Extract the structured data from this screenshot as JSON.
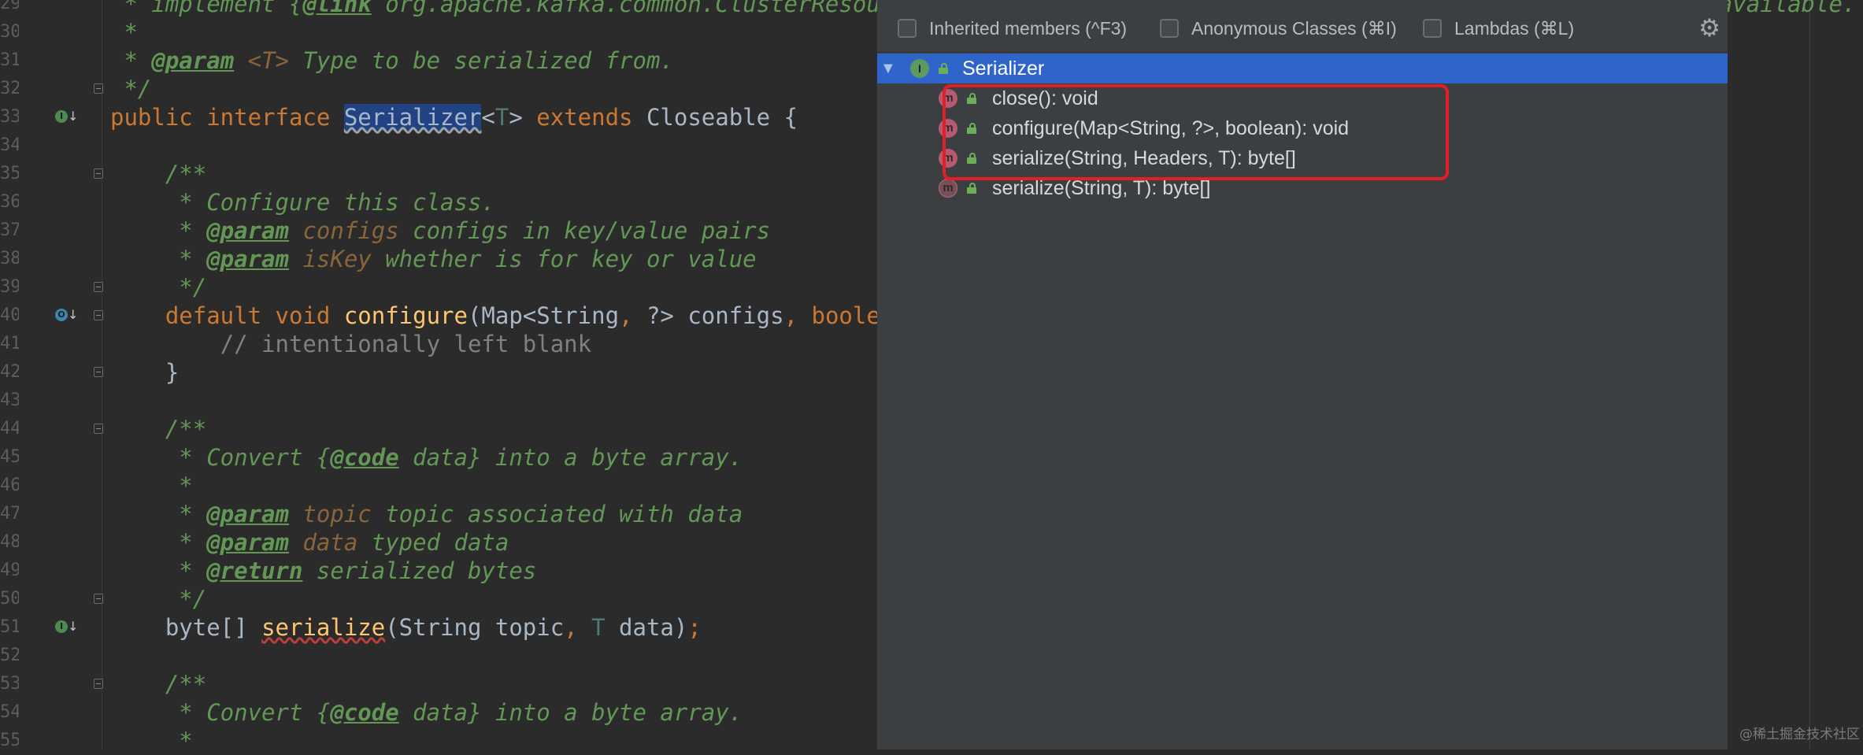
{
  "editor": {
    "lines": [
      {
        "no": "29",
        "parts": [
          {
            "t": " * implement {",
            "s": "c"
          },
          {
            "t": "@link",
            "s": "tag"
          },
          {
            "t": " org.apache.kafka.common.ClusterResourceListener} interface to receive cluster metadata once it's available. Please",
            "s": "c"
          }
        ]
      },
      {
        "no": "30",
        "parts": [
          {
            "t": " *",
            "s": "c"
          }
        ]
      },
      {
        "no": "31",
        "parts": [
          {
            "t": " * ",
            "s": "c"
          },
          {
            "t": "@param",
            "s": "tag"
          },
          {
            "t": " ",
            "s": "c"
          },
          {
            "t": "<T>",
            "s": "pn"
          },
          {
            "t": " Type to be serialized from.",
            "s": "c"
          }
        ]
      },
      {
        "no": "32",
        "fold": true,
        "parts": [
          {
            "t": " */",
            "s": "c"
          }
        ]
      },
      {
        "no": "33",
        "gicon": "I",
        "parts": [
          {
            "t": "public interface ",
            "s": "k"
          },
          {
            "t": "Serializer",
            "s": "hl"
          },
          {
            "t": "<",
            "s": ""
          },
          {
            "t": "T",
            "s": "tp"
          },
          {
            "t": "> ",
            "s": ""
          },
          {
            "t": "extends ",
            "s": "k"
          },
          {
            "t": "Closeable {",
            "s": ""
          }
        ]
      },
      {
        "no": "34",
        "parts": []
      },
      {
        "no": "35",
        "fold": true,
        "parts": [
          {
            "t": "    /**",
            "s": "c"
          }
        ]
      },
      {
        "no": "36",
        "parts": [
          {
            "t": "     * Configure this class.",
            "s": "c"
          }
        ]
      },
      {
        "no": "37",
        "parts": [
          {
            "t": "     * ",
            "s": "c"
          },
          {
            "t": "@param",
            "s": "tag"
          },
          {
            "t": " ",
            "s": "c"
          },
          {
            "t": "configs",
            "s": "pn"
          },
          {
            "t": " configs in key/value pairs",
            "s": "c"
          }
        ]
      },
      {
        "no": "38",
        "parts": [
          {
            "t": "     * ",
            "s": "c"
          },
          {
            "t": "@param",
            "s": "tag"
          },
          {
            "t": " ",
            "s": "c"
          },
          {
            "t": "isKey",
            "s": "pn"
          },
          {
            "t": " whether is for key or value",
            "s": "c"
          }
        ]
      },
      {
        "no": "39",
        "fold": true,
        "parts": [
          {
            "t": "     */",
            "s": "c"
          }
        ]
      },
      {
        "no": "40",
        "gicon": "O",
        "fold": true,
        "parts": [
          {
            "t": "    ",
            "s": ""
          },
          {
            "t": "default void ",
            "s": "k"
          },
          {
            "t": "configure",
            "s": "fn"
          },
          {
            "t": "(Map<String",
            "s": ""
          },
          {
            "t": ", ",
            "s": "k"
          },
          {
            "t": "?> configs",
            "s": ""
          },
          {
            "t": ", ",
            "s": "k"
          },
          {
            "t": "boolean",
            "s": "k"
          }
        ]
      },
      {
        "no": "41",
        "parts": [
          {
            "t": "        // intentionally left blank",
            "s": "cl"
          }
        ]
      },
      {
        "no": "42",
        "fold": true,
        "parts": [
          {
            "t": "    }",
            "s": ""
          }
        ]
      },
      {
        "no": "43",
        "parts": []
      },
      {
        "no": "44",
        "fold": true,
        "parts": [
          {
            "t": "    /**",
            "s": "c"
          }
        ]
      },
      {
        "no": "45",
        "parts": [
          {
            "t": "     * Convert {",
            "s": "c"
          },
          {
            "t": "@code",
            "s": "tag"
          },
          {
            "t": " data} into a byte array.",
            "s": "c"
          }
        ]
      },
      {
        "no": "46",
        "parts": [
          {
            "t": "     *",
            "s": "c"
          }
        ]
      },
      {
        "no": "47",
        "parts": [
          {
            "t": "     * ",
            "s": "c"
          },
          {
            "t": "@param",
            "s": "tag"
          },
          {
            "t": " ",
            "s": "c"
          },
          {
            "t": "topic",
            "s": "pn"
          },
          {
            "t": " topic associated with data",
            "s": "c"
          }
        ]
      },
      {
        "no": "48",
        "parts": [
          {
            "t": "     * ",
            "s": "c"
          },
          {
            "t": "@param",
            "s": "tag"
          },
          {
            "t": " ",
            "s": "c"
          },
          {
            "t": "data",
            "s": "pn"
          },
          {
            "t": " typed data",
            "s": "c"
          }
        ]
      },
      {
        "no": "49",
        "parts": [
          {
            "t": "     * ",
            "s": "c"
          },
          {
            "t": "@return",
            "s": "tag"
          },
          {
            "t": " serialized bytes",
            "s": "c"
          }
        ]
      },
      {
        "no": "50",
        "fold": true,
        "parts": [
          {
            "t": "     */",
            "s": "c"
          }
        ]
      },
      {
        "no": "51",
        "gicon": "I",
        "parts": [
          {
            "t": "    byte[] ",
            "s": ""
          },
          {
            "t": "serialize",
            "s": "sqfn"
          },
          {
            "t": "(String topic",
            "s": ""
          },
          {
            "t": ", ",
            "s": "k"
          },
          {
            "t": "T",
            "s": "tp"
          },
          {
            "t": " data)",
            "s": ""
          },
          {
            "t": ";",
            "s": "k"
          }
        ]
      },
      {
        "no": "52",
        "parts": []
      },
      {
        "no": "53",
        "fold": true,
        "parts": [
          {
            "t": "    /**",
            "s": "c"
          }
        ]
      },
      {
        "no": "54",
        "parts": [
          {
            "t": "     * Convert {",
            "s": "c"
          },
          {
            "t": "@code",
            "s": "tag"
          },
          {
            "t": " data} into a byte array.",
            "s": "c"
          }
        ]
      },
      {
        "no": "55",
        "parts": [
          {
            "t": "     *",
            "s": "c"
          }
        ]
      }
    ]
  },
  "structure_popup": {
    "filters": [
      {
        "label": "Inherited members (^F3)",
        "checked": false
      },
      {
        "label": "Anonymous Classes (⌘I)",
        "checked": false
      },
      {
        "label": "Lambdas (⌘L)",
        "checked": false
      }
    ],
    "settings_icon": "gear-icon",
    "root": {
      "label": "Serializer",
      "kind_icon": "I",
      "expanded": true,
      "selected": true
    },
    "members": [
      {
        "label": "close(): void",
        "kind_icon": "m",
        "abstract": false
      },
      {
        "label": "configure(Map<String, ?>, boolean): void",
        "kind_icon": "m",
        "abstract": false
      },
      {
        "label": "serialize(String, Headers, T): byte[]",
        "kind_icon": "m",
        "abstract": false
      },
      {
        "label": "serialize(String, T): byte[]",
        "kind_icon": "m",
        "abstract": true
      }
    ]
  },
  "watermark": "@稀土掘金技术社区",
  "colors": {
    "selection": "#2f65ca",
    "highlight_box": "#e01f26",
    "background": "#2b2b2b"
  }
}
